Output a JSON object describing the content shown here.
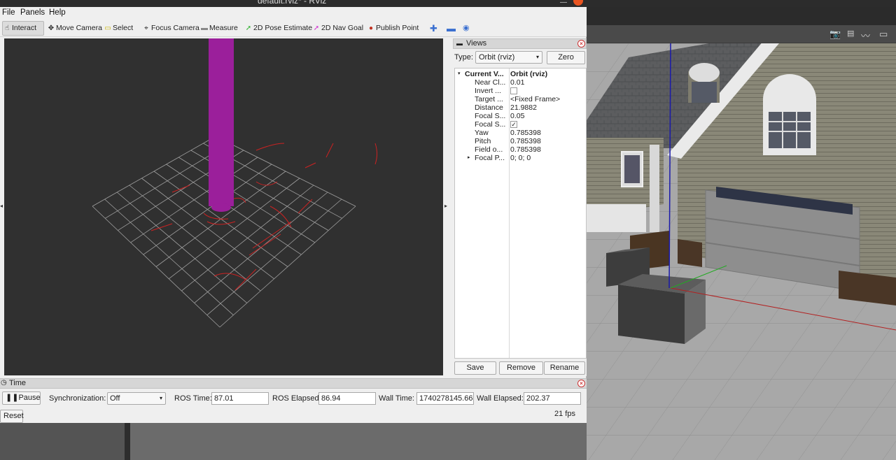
{
  "window_title": "default.rviz* - RViz",
  "menu": [
    "File",
    "Panels",
    "Help"
  ],
  "tools": [
    {
      "label": "Interact",
      "icon": "interact-icon",
      "glyph": "☝"
    },
    {
      "label": "Move Camera",
      "icon": "move-camera-icon",
      "glyph": "✥"
    },
    {
      "label": "Select",
      "icon": "select-icon",
      "glyph": "▭"
    },
    {
      "label": "Focus Camera",
      "icon": "focus-camera-icon",
      "glyph": "⌖"
    },
    {
      "label": "Measure",
      "icon": "measure-icon",
      "glyph": "▬"
    },
    {
      "label": "2D Pose Estimate",
      "icon": "pose-estimate-icon",
      "glyph": "➚"
    },
    {
      "label": "2D Nav Goal",
      "icon": "nav-goal-icon",
      "glyph": "➚"
    },
    {
      "label": "Publish Point",
      "icon": "publish-point-icon",
      "glyph": "📍"
    }
  ],
  "views": {
    "title": "Views",
    "type_label": "Type:",
    "type_value": "Orbit (rviz)",
    "zero": "Zero",
    "rows": [
      {
        "key": "Current V...",
        "value": "Orbit (rviz)",
        "bold": true
      },
      {
        "key": "Near Cl...",
        "value": "0.01"
      },
      {
        "key": "Invert ...",
        "value": "",
        "checkbox": false
      },
      {
        "key": "Target ...",
        "value": "<Fixed Frame>"
      },
      {
        "key": "Distance",
        "value": "21.9882"
      },
      {
        "key": "Focal S...",
        "value": "0.05"
      },
      {
        "key": "Focal S...",
        "value": "",
        "checkbox": true
      },
      {
        "key": "Yaw",
        "value": "0.785398"
      },
      {
        "key": "Pitch",
        "value": "0.785398"
      },
      {
        "key": "Field o...",
        "value": "0.785398"
      },
      {
        "key": "Focal P...",
        "value": "0; 0; 0"
      }
    ],
    "save": "Save",
    "remove": "Remove",
    "rename": "Rename"
  },
  "time": {
    "title": "Time",
    "pause": "Pause",
    "sync_label": "Synchronization:",
    "sync_value": "Off",
    "ros_time_label": "ROS Time:",
    "ros_time": "87.01",
    "ros_elapsed_label": "ROS Elapsed:",
    "ros_elapsed": "86.94",
    "wall_time_label": "Wall Time:",
    "wall_time": "1740278145.66",
    "wall_elapsed_label": "Wall Elapsed:",
    "wall_elapsed": "202.37",
    "reset": "Reset",
    "fps": "21 fps"
  },
  "colors": {
    "grid": "#a0a0a0",
    "laser": "#cc2222",
    "cylinder": "#9b1f9b",
    "viewport_bg": "#303030"
  }
}
